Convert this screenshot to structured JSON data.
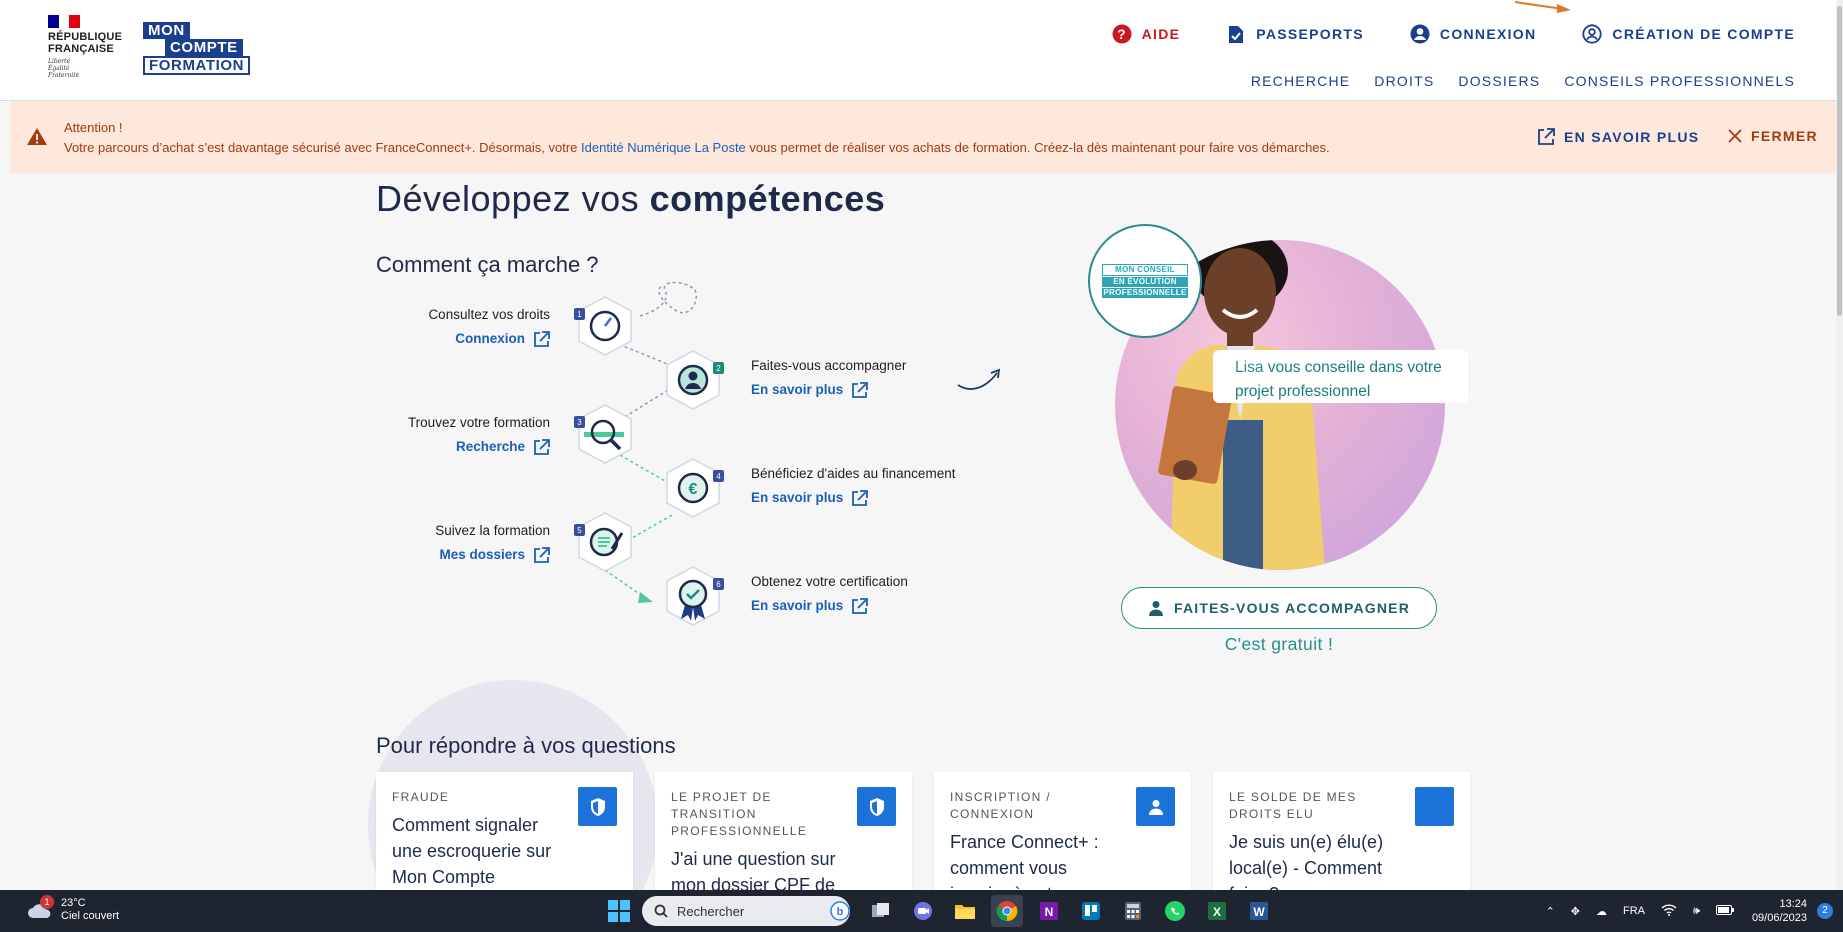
{
  "header": {
    "rf_logo": {
      "line1": "RÉPUBLIQUE",
      "line2": "FRANÇAISE",
      "motto1": "Liberté",
      "motto2": "Égalité",
      "motto3": "Fraternité"
    },
    "mcf_logo": {
      "w1": "MON",
      "w2": "COMPTE",
      "w3": "FORMATION"
    },
    "topnav": {
      "aide": "AIDE",
      "passeports": "PASSEPORTS",
      "connexion": "CONNEXION",
      "creation": "CRÉATION DE COMPTE"
    },
    "subnav": {
      "recherche": "RECHERCHE",
      "droits": "DROITS",
      "dossiers": "DOSSIERS",
      "conseils": "CONSEILS PROFESSIONNELS"
    }
  },
  "alert": {
    "title": "Attention !",
    "msg_before": "Votre parcours d’achat s’est davantage sécurisé avec FranceConnect+. Désormais, votre ",
    "msg_link": "Identité Numérique La Poste",
    "msg_after": " vous permet de réaliser vos achats de formation. Créez-la dès maintenant pour faire vos démarches.",
    "more": "EN SAVOIR PLUS",
    "close": "FERMER"
  },
  "main": {
    "title_start": "Développez vos ",
    "title_bold": "compétences",
    "how_title": "Comment ça marche ?",
    "steps": [
      {
        "num": "1",
        "label": "Consultez vos droits",
        "link": "Connexion"
      },
      {
        "num": "2",
        "label": "Faites-vous accompagner",
        "link": "En savoir plus"
      },
      {
        "num": "3",
        "label": "Trouvez votre formation",
        "link": "Recherche"
      },
      {
        "num": "4",
        "label": "Bénéficiez d'aides au financement",
        "link": "En savoir plus"
      },
      {
        "num": "5",
        "label": "Suivez la formation",
        "link": "Mes dossiers"
      },
      {
        "num": "6",
        "label": "Obtenez votre certification",
        "link": "En savoir plus"
      }
    ],
    "badge": {
      "l1": "MON CONSEIL",
      "l2": "EN ÉVOLUTION",
      "l3": "PROFESSIONNELLE"
    },
    "quote_name": "Lisa",
    "quote_rest": " vous conseille dans votre projet professionnel",
    "cta": "FAITES-VOUS ACCOMPAGNER",
    "free": "C'est gratuit !",
    "faq_title": "Pour répondre à vos questions",
    "cards": [
      {
        "cat": "FRAUDE",
        "q": "Comment signaler une escroquerie sur Mon Compte"
      },
      {
        "cat": "LE PROJET DE TRANSITION PROFESSIONNELLE",
        "q": "J'ai une question sur mon dossier CPF de transition, qui"
      },
      {
        "cat": "INSCRIPTION / CONNEXION",
        "q": "France Connect+ : comment vous inscrire à votre"
      },
      {
        "cat": "LE SOLDE DE MES DROITS ELU",
        "q": "Je suis un(e) élu(e) local(e) - Comment faire ?"
      }
    ]
  },
  "taskbar": {
    "weather_badge": "1",
    "temp": "23°C",
    "weather": "Ciel couvert",
    "search_placeholder": "Rechercher",
    "lang": "FRA",
    "time": "13:24",
    "date": "09/06/2023",
    "notif": "2"
  },
  "colors": {
    "brand_blue": "#1b3f8f",
    "link_blue": "#1b5fb8",
    "alert_bg": "#fde8db",
    "alert_text": "#a33a12",
    "teal": "#2a8c8c",
    "aide_red": "#c9191e"
  }
}
